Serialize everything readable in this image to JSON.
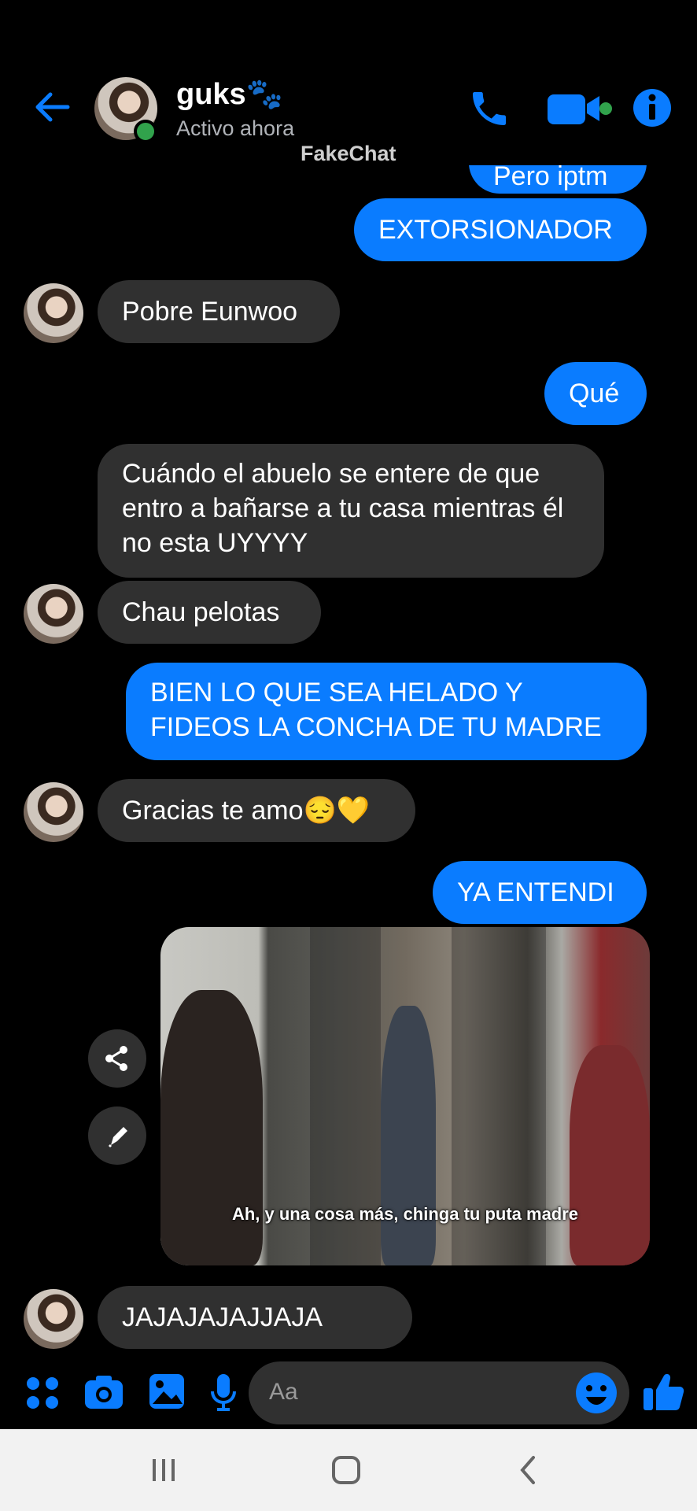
{
  "header": {
    "contact_name": "guks🐾",
    "status": "Activo ahora",
    "watermark": "FakeChat"
  },
  "messages": [
    {
      "from": "me",
      "text": "Pero iptm"
    },
    {
      "from": "me",
      "text": "EXTORSIONADOR"
    },
    {
      "from": "them",
      "text": "Pobre Eunwoo"
    },
    {
      "from": "me",
      "text": "Qué"
    },
    {
      "from": "them",
      "text": "Cuándo el abuelo se entere de que entro a bañarse a tu casa mientras él no esta UYYYY"
    },
    {
      "from": "them",
      "text": "Chau pelotas"
    },
    {
      "from": "me",
      "text": "BIEN LO QUE SEA HELADO Y FIDEOS LA CONCHA DE TU MADRE"
    },
    {
      "from": "them",
      "text": "Gracias te amo😔💛"
    },
    {
      "from": "me",
      "text": "YA ENTENDI"
    },
    {
      "from": "me",
      "type": "image",
      "caption": "Ah, y una cosa más, chinga tu puta madre"
    },
    {
      "from": "them",
      "text": "JAJAJAJAJJAJA"
    }
  ],
  "composer": {
    "placeholder": "Aa"
  },
  "colors": {
    "accent": "#0a7cff",
    "incoming_bubble": "#303030",
    "online": "#31a24c"
  },
  "icons": [
    "back-arrow-icon",
    "phone-icon",
    "video-camera-icon",
    "info-icon",
    "share-icon",
    "edit-pencil-icon",
    "apps-icon",
    "camera-icon",
    "gallery-icon",
    "microphone-icon",
    "emoji-icon",
    "thumbs-up-icon",
    "recents-nav-icon",
    "home-nav-icon",
    "back-nav-icon"
  ]
}
